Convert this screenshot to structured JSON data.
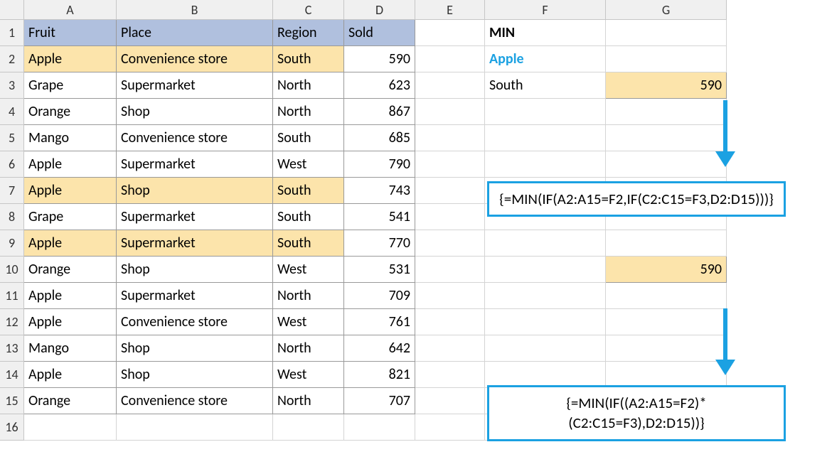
{
  "columns": [
    "A",
    "B",
    "C",
    "D",
    "E",
    "F",
    "G"
  ],
  "rowCount": 16,
  "header": {
    "a": "Fruit",
    "b": "Place",
    "c": "Region",
    "d": "Sold"
  },
  "rows": [
    {
      "a": "Apple",
      "b": "Convenience store",
      "c": "South",
      "d": 590,
      "hl": true
    },
    {
      "a": "Grape",
      "b": "Supermarket",
      "c": "North",
      "d": 623
    },
    {
      "a": "Orange",
      "b": "Shop",
      "c": "North",
      "d": 867
    },
    {
      "a": "Mango",
      "b": "Convenience store",
      "c": "South",
      "d": 685
    },
    {
      "a": "Apple",
      "b": "Supermarket",
      "c": "West",
      "d": 790
    },
    {
      "a": "Apple",
      "b": "Shop",
      "c": "South",
      "d": 743,
      "hl": true
    },
    {
      "a": "Grape",
      "b": "Supermarket",
      "c": "South",
      "d": 541
    },
    {
      "a": "Apple",
      "b": "Supermarket",
      "c": "South",
      "d": 770,
      "hl": true
    },
    {
      "a": "Orange",
      "b": "Shop",
      "c": "West",
      "d": 531
    },
    {
      "a": "Apple",
      "b": "Supermarket",
      "c": "North",
      "d": 709
    },
    {
      "a": "Apple",
      "b": "Convenience store",
      "c": "West",
      "d": 761
    },
    {
      "a": "Mango",
      "b": "Shop",
      "c": "North",
      "d": 642
    },
    {
      "a": "Apple",
      "b": "Shop",
      "c": "West",
      "d": 821
    },
    {
      "a": "Orange",
      "b": "Convenience store",
      "c": "North",
      "d": 707
    }
  ],
  "criteria": {
    "f1": "MIN",
    "f2": "Apple",
    "f3": "South",
    "g3": 590,
    "g10": 590
  },
  "formulas": {
    "f1": "{=MIN(IF(A2:A15=F2,IF(C2:C15=F3,D2:D15)))}",
    "f2": "{=MIN(IF((A2:A15=F2)*(C2:C15=F3),D2:D15))}"
  }
}
